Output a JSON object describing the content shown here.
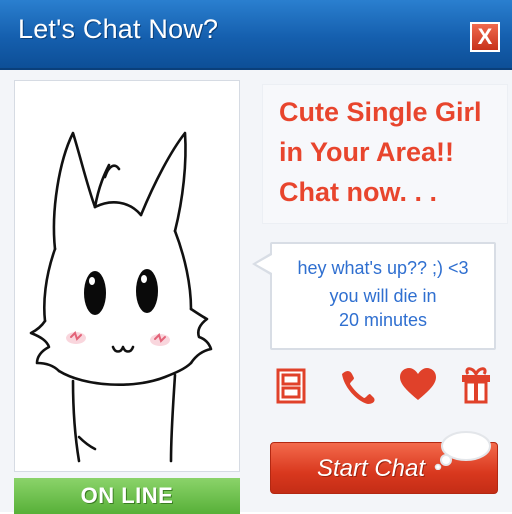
{
  "window": {
    "title": "Let's Chat Now?",
    "close_label": "X"
  },
  "profile": {
    "status": "ON LINE"
  },
  "headline": {
    "lines": [
      "Cute Single Girl",
      "in  Your  Area!!",
      "Chat now. . ."
    ]
  },
  "bubble": {
    "lines": [
      "hey what's up?? ;) <3",
      "you will die in",
      "20 minutes"
    ]
  },
  "actions": {
    "icons": [
      "video-icon",
      "phone-icon",
      "heart-icon",
      "gift-icon"
    ],
    "start_chat_label": "Start Chat"
  },
  "colors": {
    "title_bar": "#155fae",
    "headline": "#e8452d",
    "bubble_text": "#2f6fd0",
    "online": "#57b038",
    "start_button": "#d9381e"
  }
}
